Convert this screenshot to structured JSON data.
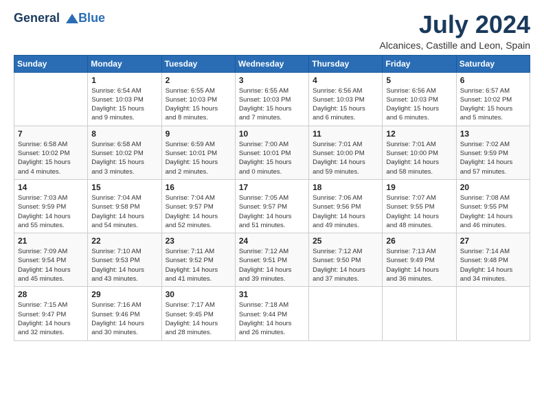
{
  "header": {
    "logo_line1": "General",
    "logo_line2": "Blue",
    "month_year": "July 2024",
    "location": "Alcanices, Castille and Leon, Spain"
  },
  "weekdays": [
    "Sunday",
    "Monday",
    "Tuesday",
    "Wednesday",
    "Thursday",
    "Friday",
    "Saturday"
  ],
  "weeks": [
    [
      {
        "day": "",
        "info": ""
      },
      {
        "day": "1",
        "info": "Sunrise: 6:54 AM\nSunset: 10:03 PM\nDaylight: 15 hours\nand 9 minutes."
      },
      {
        "day": "2",
        "info": "Sunrise: 6:55 AM\nSunset: 10:03 PM\nDaylight: 15 hours\nand 8 minutes."
      },
      {
        "day": "3",
        "info": "Sunrise: 6:55 AM\nSunset: 10:03 PM\nDaylight: 15 hours\nand 7 minutes."
      },
      {
        "day": "4",
        "info": "Sunrise: 6:56 AM\nSunset: 10:03 PM\nDaylight: 15 hours\nand 6 minutes."
      },
      {
        "day": "5",
        "info": "Sunrise: 6:56 AM\nSunset: 10:03 PM\nDaylight: 15 hours\nand 6 minutes."
      },
      {
        "day": "6",
        "info": "Sunrise: 6:57 AM\nSunset: 10:02 PM\nDaylight: 15 hours\nand 5 minutes."
      }
    ],
    [
      {
        "day": "7",
        "info": "Sunrise: 6:58 AM\nSunset: 10:02 PM\nDaylight: 15 hours\nand 4 minutes."
      },
      {
        "day": "8",
        "info": "Sunrise: 6:58 AM\nSunset: 10:02 PM\nDaylight: 15 hours\nand 3 minutes."
      },
      {
        "day": "9",
        "info": "Sunrise: 6:59 AM\nSunset: 10:01 PM\nDaylight: 15 hours\nand 2 minutes."
      },
      {
        "day": "10",
        "info": "Sunrise: 7:00 AM\nSunset: 10:01 PM\nDaylight: 15 hours\nand 0 minutes."
      },
      {
        "day": "11",
        "info": "Sunrise: 7:01 AM\nSunset: 10:00 PM\nDaylight: 14 hours\nand 59 minutes."
      },
      {
        "day": "12",
        "info": "Sunrise: 7:01 AM\nSunset: 10:00 PM\nDaylight: 14 hours\nand 58 minutes."
      },
      {
        "day": "13",
        "info": "Sunrise: 7:02 AM\nSunset: 9:59 PM\nDaylight: 14 hours\nand 57 minutes."
      }
    ],
    [
      {
        "day": "14",
        "info": "Sunrise: 7:03 AM\nSunset: 9:59 PM\nDaylight: 14 hours\nand 55 minutes."
      },
      {
        "day": "15",
        "info": "Sunrise: 7:04 AM\nSunset: 9:58 PM\nDaylight: 14 hours\nand 54 minutes."
      },
      {
        "day": "16",
        "info": "Sunrise: 7:04 AM\nSunset: 9:57 PM\nDaylight: 14 hours\nand 52 minutes."
      },
      {
        "day": "17",
        "info": "Sunrise: 7:05 AM\nSunset: 9:57 PM\nDaylight: 14 hours\nand 51 minutes."
      },
      {
        "day": "18",
        "info": "Sunrise: 7:06 AM\nSunset: 9:56 PM\nDaylight: 14 hours\nand 49 minutes."
      },
      {
        "day": "19",
        "info": "Sunrise: 7:07 AM\nSunset: 9:55 PM\nDaylight: 14 hours\nand 48 minutes."
      },
      {
        "day": "20",
        "info": "Sunrise: 7:08 AM\nSunset: 9:55 PM\nDaylight: 14 hours\nand 46 minutes."
      }
    ],
    [
      {
        "day": "21",
        "info": "Sunrise: 7:09 AM\nSunset: 9:54 PM\nDaylight: 14 hours\nand 45 minutes."
      },
      {
        "day": "22",
        "info": "Sunrise: 7:10 AM\nSunset: 9:53 PM\nDaylight: 14 hours\nand 43 minutes."
      },
      {
        "day": "23",
        "info": "Sunrise: 7:11 AM\nSunset: 9:52 PM\nDaylight: 14 hours\nand 41 minutes."
      },
      {
        "day": "24",
        "info": "Sunrise: 7:12 AM\nSunset: 9:51 PM\nDaylight: 14 hours\nand 39 minutes."
      },
      {
        "day": "25",
        "info": "Sunrise: 7:12 AM\nSunset: 9:50 PM\nDaylight: 14 hours\nand 37 minutes."
      },
      {
        "day": "26",
        "info": "Sunrise: 7:13 AM\nSunset: 9:49 PM\nDaylight: 14 hours\nand 36 minutes."
      },
      {
        "day": "27",
        "info": "Sunrise: 7:14 AM\nSunset: 9:48 PM\nDaylight: 14 hours\nand 34 minutes."
      }
    ],
    [
      {
        "day": "28",
        "info": "Sunrise: 7:15 AM\nSunset: 9:47 PM\nDaylight: 14 hours\nand 32 minutes."
      },
      {
        "day": "29",
        "info": "Sunrise: 7:16 AM\nSunset: 9:46 PM\nDaylight: 14 hours\nand 30 minutes."
      },
      {
        "day": "30",
        "info": "Sunrise: 7:17 AM\nSunset: 9:45 PM\nDaylight: 14 hours\nand 28 minutes."
      },
      {
        "day": "31",
        "info": "Sunrise: 7:18 AM\nSunset: 9:44 PM\nDaylight: 14 hours\nand 26 minutes."
      },
      {
        "day": "",
        "info": ""
      },
      {
        "day": "",
        "info": ""
      },
      {
        "day": "",
        "info": ""
      }
    ]
  ]
}
